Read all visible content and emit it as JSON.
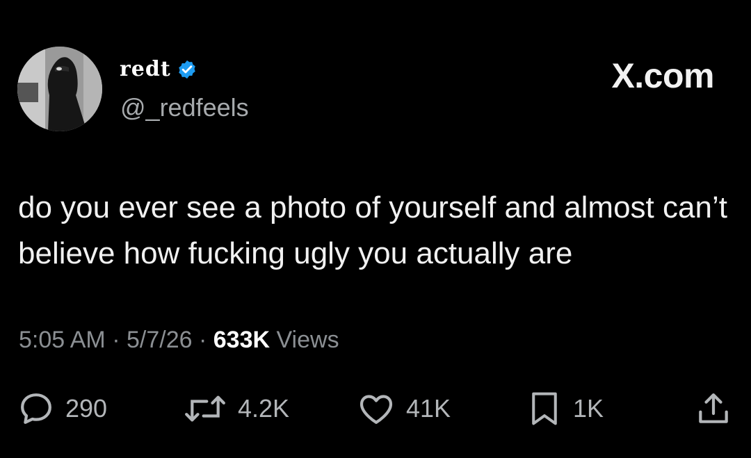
{
  "author": {
    "display_name": "redt",
    "handle": "@_redfeels",
    "verified": true
  },
  "brand": "X.com",
  "tweet": {
    "text": "do you ever see a photo of yourself and almost can’t believe how fucking ugly you actually are"
  },
  "meta": {
    "time": "5:05 AM",
    "separator": "·",
    "date": "5/7/26",
    "views_count": "633K",
    "views_label": "Views"
  },
  "actions": {
    "replies": "290",
    "reposts": "4.2K",
    "likes": "41K",
    "bookmarks": "1K"
  },
  "colors": {
    "background": "#000000",
    "text": "#e7e9ea",
    "muted": "#8b8f93",
    "verified_blue": "#1d9bf0"
  }
}
